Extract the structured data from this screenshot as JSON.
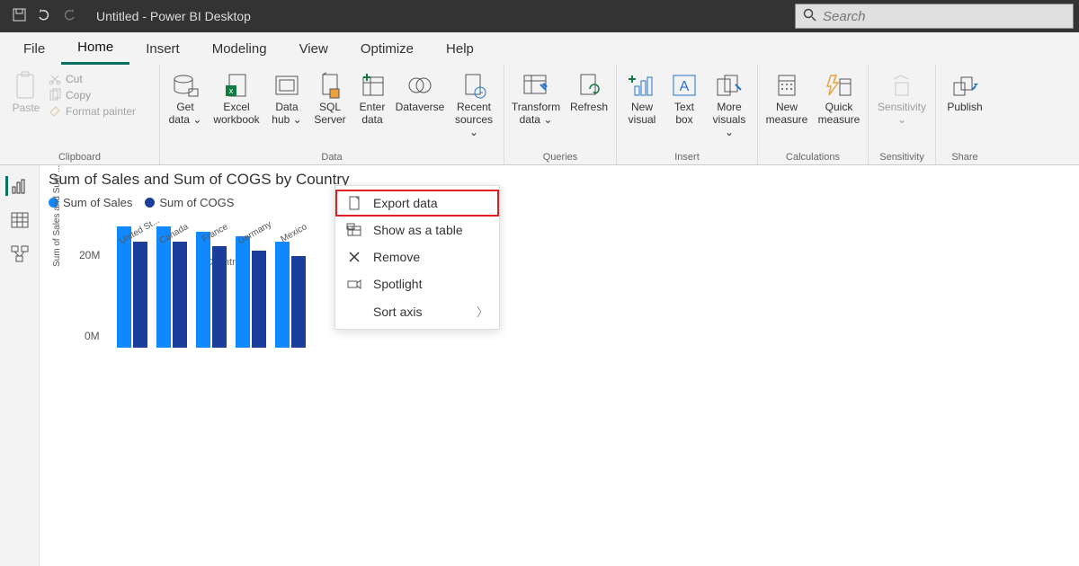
{
  "titlebar": {
    "title": "Untitled - Power BI Desktop",
    "search_placeholder": "Search"
  },
  "tabs": {
    "file": "File",
    "home": "Home",
    "insert": "Insert",
    "modeling": "Modeling",
    "view": "View",
    "optimize": "Optimize",
    "help": "Help"
  },
  "ribbon": {
    "clipboard": {
      "paste": "Paste",
      "cut": "Cut",
      "copy": "Copy",
      "format_painter": "Format painter",
      "group": "Clipboard"
    },
    "data": {
      "get_data": "Get data",
      "excel": "Excel workbook",
      "data_hub": "Data hub",
      "sql": "SQL Server",
      "enter": "Enter data",
      "dataverse": "Dataverse",
      "recent": "Recent sources",
      "group": "Data"
    },
    "queries": {
      "transform": "Transform data",
      "refresh": "Refresh",
      "group": "Queries"
    },
    "insert": {
      "visual": "New visual",
      "textbox": "Text box",
      "more": "More visuals",
      "group": "Insert"
    },
    "calc": {
      "new_measure": "New measure",
      "quick": "Quick measure",
      "group": "Calculations"
    },
    "sens": {
      "sensitivity": "Sensitivity",
      "group": "Sensitivity"
    },
    "share": {
      "publish": "Publish",
      "group": "Share"
    }
  },
  "context_menu": {
    "export": "Export data",
    "table": "Show as a table",
    "remove": "Remove",
    "spotlight": "Spotlight",
    "sort": "Sort axis"
  },
  "chart_data": {
    "type": "bar",
    "title": "Sum of Sales and Sum of COGS by Country",
    "legend": [
      "Sum of  Sales",
      "Sum of COGS"
    ],
    "colors": {
      "sales": "#1089ff",
      "cogs": "#1b3e9b"
    },
    "categories": [
      "United St...",
      "Canada",
      "France",
      "Germany",
      "Mexico"
    ],
    "series": [
      {
        "name": "Sum of Sales",
        "values": [
          25,
          25,
          24,
          23,
          22
        ]
      },
      {
        "name": "Sum of COGS",
        "values": [
          22,
          22,
          21,
          20,
          19
        ]
      }
    ],
    "ylabel": "Sum of Sales and Sum ...",
    "xlabel": "Country",
    "yticks": [
      "20M",
      "0M"
    ],
    "ylim": [
      0,
      26
    ]
  }
}
